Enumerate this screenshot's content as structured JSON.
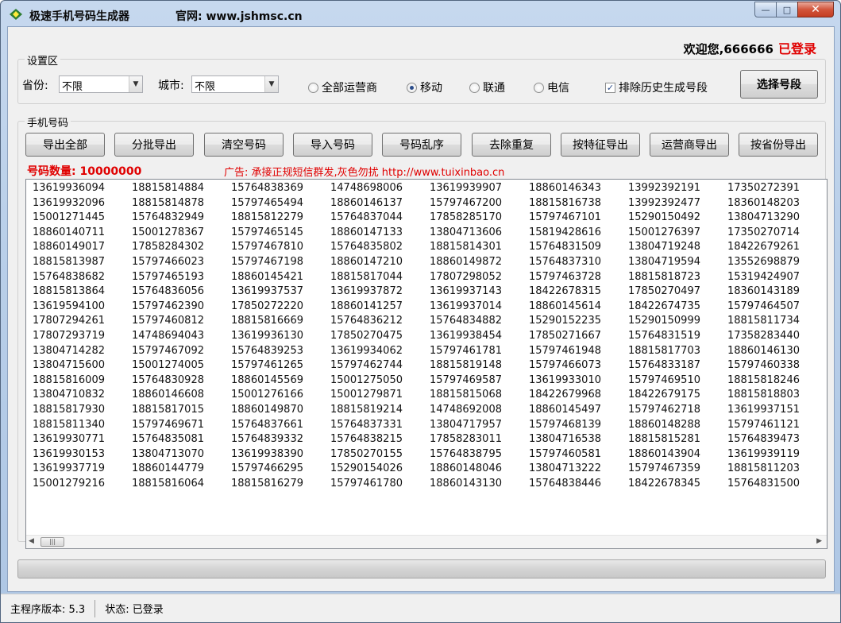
{
  "window": {
    "title": "极速手机号码生成器",
    "site": "官网: www.jshmsc.cn",
    "minimize": "—",
    "maximize": "□",
    "close": "✕"
  },
  "header": {
    "welcome": "欢迎您,666666",
    "status": "已登录"
  },
  "settings": {
    "group_title": "设置区",
    "province_label": "省份:",
    "province_value": "不限",
    "city_label": "城市:",
    "city_value": "不限",
    "radios": [
      {
        "label": "全部运营商",
        "checked": false
      },
      {
        "label": "移动",
        "checked": true
      },
      {
        "label": "联通",
        "checked": false
      },
      {
        "label": "电信",
        "checked": false
      }
    ],
    "exclude_history_label": "排除历史生成号段",
    "exclude_history_checked": true,
    "select_button": "选择号段"
  },
  "numbers_section": {
    "group_title": "手机号码",
    "buttons": [
      "导出全部",
      "分批导出",
      "清空号码",
      "导入号码",
      "号码乱序",
      "去除重复",
      "按特征导出",
      "运营商导出",
      "按省份导出"
    ],
    "count_label": "号码数量: 10000000",
    "ad": "广告: 承接正规短信群发,灰色勿扰 http://www.tuixinbao.cn"
  },
  "number_rows": [
    [
      "13619936094",
      "18815814884",
      "15764838369",
      "14748698006",
      "13619939907",
      "18860146343",
      "13992392191",
      "17350272391"
    ],
    [
      "13619932096",
      "18815814878",
      "15797465494",
      "18860146137",
      "15797467200",
      "18815816738",
      "13992392477",
      "18360148203"
    ],
    [
      "15001271445",
      "15764832949",
      "18815812279",
      "15764837044",
      "17858285170",
      "15797467101",
      "15290150492",
      "13804713290"
    ],
    [
      "18860140711",
      "15001278367",
      "15797465145",
      "18860147133",
      "13804713606",
      "15819428616",
      "15001276397",
      "17350270714"
    ],
    [
      "18860149017",
      "17858284302",
      "15797467810",
      "15764835802",
      "18815814301",
      "15764831509",
      "13804719248",
      "18422679261"
    ],
    [
      "18815813987",
      "15797466023",
      "15797467198",
      "18860147210",
      "18860149872",
      "15764837310",
      "13804719594",
      "13552698879"
    ],
    [
      "15764838682",
      "15797465193",
      "18860145421",
      "18815817044",
      "17807298052",
      "15797463728",
      "18815818723",
      "15319424907"
    ],
    [
      "18815813864",
      "15764836056",
      "13619937537",
      "13619937872",
      "13619937143",
      "18422678315",
      "17850270497",
      "18360143189"
    ],
    [
      "13619594100",
      "15797462390",
      "17850272220",
      "18860141257",
      "13619937014",
      "18860145614",
      "18422674735",
      "15797464507"
    ],
    [
      "17807294261",
      "15797460812",
      "18815816669",
      "15764836212",
      "15764834882",
      "15290152235",
      "15290150999",
      "18815811734"
    ],
    [
      "17807293719",
      "14748694043",
      "13619936130",
      "17850270475",
      "13619938454",
      "17850271667",
      "15764831519",
      "17358283440"
    ],
    [
      "13804714282",
      "15797467092",
      "15764839253",
      "13619934062",
      "15797461781",
      "15797461948",
      "18815817703",
      "18860146130"
    ],
    [
      "13804715600",
      "15001274005",
      "15797461265",
      "15797462744",
      "18815819148",
      "15797466073",
      "15764833187",
      "15797460338"
    ],
    [
      "18815816009",
      "15764830928",
      "18860145569",
      "15001275050",
      "15797469587",
      "13619933010",
      "15797469510",
      "18815818246"
    ],
    [
      "13804710832",
      "18860146608",
      "15001276166",
      "15001279871",
      "18815815068",
      "18422679968",
      "18422679175",
      "18815818803"
    ],
    [
      "18815817930",
      "18815817015",
      "18860149870",
      "18815819214",
      "14748692008",
      "18860145497",
      "15797462718",
      "13619937151"
    ],
    [
      "18815811340",
      "15797469671",
      "15764837661",
      "15764837331",
      "13804717957",
      "15797468139",
      "18860148288",
      "15797461121"
    ],
    [
      "13619930771",
      "15764835081",
      "15764839332",
      "15764838215",
      "17858283011",
      "13804716538",
      "18815815281",
      "15764839473"
    ],
    [
      "13619930153",
      "13804713070",
      "13619938390",
      "17850270155",
      "15764838795",
      "15797460581",
      "18860143904",
      "13619939119"
    ],
    [
      "13619937719",
      "18860144779",
      "15797466295",
      "15290154026",
      "18860148046",
      "13804713222",
      "15797467359",
      "18815811203"
    ],
    [
      "15001279216",
      "18815816064",
      "18815816279",
      "15797461780",
      "18860143130",
      "15764838446",
      "18422678345",
      "15764831500"
    ]
  ],
  "progress_fraction": 0.0,
  "status": {
    "version": "主程序版本: 5.3",
    "state": "状态: 已登录"
  },
  "colors": {
    "accent_red": "#e00000",
    "title_bar": "#b9cfe9"
  }
}
